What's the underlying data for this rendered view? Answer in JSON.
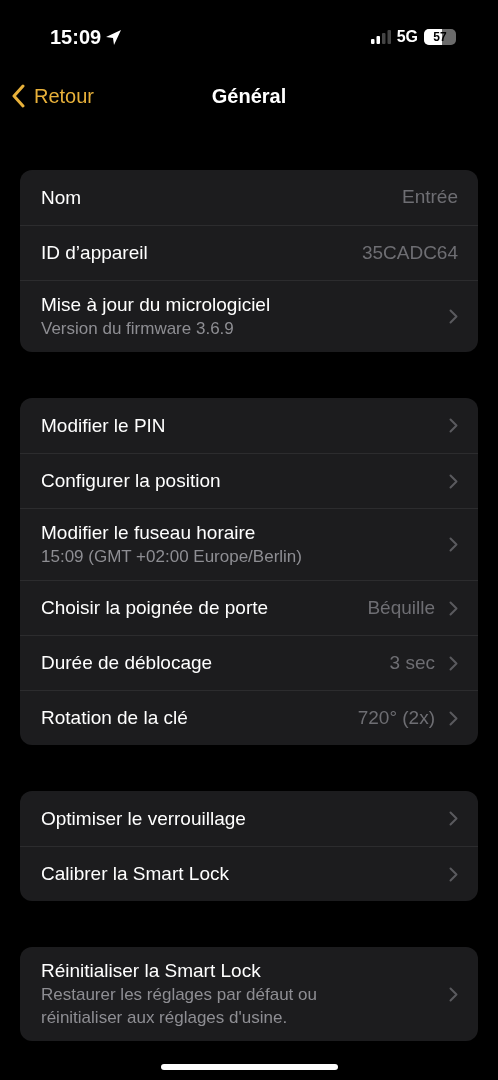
{
  "status_bar": {
    "time": "15:09",
    "network": "5G",
    "battery": "57"
  },
  "nav": {
    "back": "Retour",
    "title": "Général"
  },
  "groups": [
    {
      "rows": [
        {
          "title": "Nom",
          "value": "Entrée",
          "chevron": false
        },
        {
          "title": "ID d’appareil",
          "value": "35CADC64",
          "chevron": false
        },
        {
          "title": "Mise à jour du micrologiciel",
          "subtitle": "Version du firmware 3.6.9",
          "chevron": true
        }
      ]
    },
    {
      "rows": [
        {
          "title": "Modifier le PIN",
          "chevron": true
        },
        {
          "title": "Configurer la position",
          "chevron": true
        },
        {
          "title": "Modifier le fuseau horaire",
          "subtitle": "15:09 (GMT +02:00 Europe/Berlin)",
          "chevron": true
        },
        {
          "title": "Choisir la poignée de porte",
          "value": "Béquille",
          "chevron": true
        },
        {
          "title": "Durée de déblocage",
          "value": "3 sec",
          "chevron": true
        },
        {
          "title": "Rotation de la clé",
          "value": "720° (2x)",
          "chevron": true
        }
      ]
    },
    {
      "rows": [
        {
          "title": "Optimiser le verrouillage",
          "chevron": true
        },
        {
          "title": "Calibrer la Smart Lock",
          "chevron": true
        }
      ]
    },
    {
      "rows": [
        {
          "title": "Réinitialiser la Smart Lock",
          "subtitle": "Restaurer les réglages par défaut ou réinitialiser aux réglages d'usine.",
          "chevron": true
        }
      ]
    }
  ]
}
